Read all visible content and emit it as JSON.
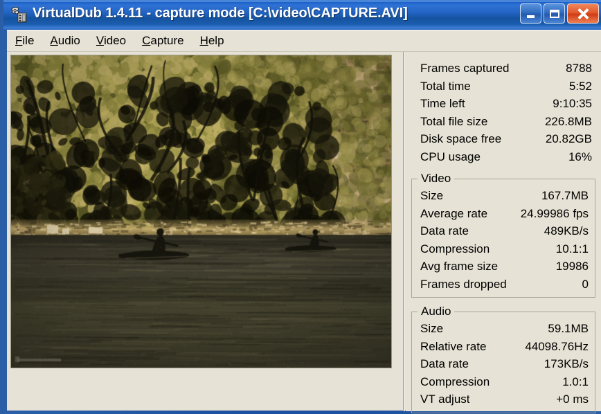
{
  "window": {
    "title": "VirtualDub 1.4.11 - capture mode [C:\\video\\CAPTURE.AVI]",
    "icon": "virtualdub-gear-icon",
    "titlebar_color": "#1d63cb",
    "client_bg": "#e6e2d5",
    "caption_buttons": {
      "minimize": "minimize-icon",
      "maximize": "maximize-icon",
      "close": "close-icon"
    }
  },
  "menubar": {
    "items": [
      {
        "label": "File",
        "accel": "F"
      },
      {
        "label": "Audio",
        "accel": "A"
      },
      {
        "label": "Video",
        "accel": "V"
      },
      {
        "label": "Capture",
        "accel": "C"
      },
      {
        "label": "Help",
        "accel": "H"
      }
    ]
  },
  "preview": {
    "name": "video-preview",
    "description": "Live capture preview: two kayakers paddling on a dark river below a sunlit vegetated cliff"
  },
  "stats": {
    "general": [
      {
        "label": "Frames captured",
        "value": "8788"
      },
      {
        "label": "Total time",
        "value": "5:52"
      },
      {
        "label": "Time left",
        "value": "9:10:35"
      },
      {
        "label": "Total file size",
        "value": "226.8MB"
      },
      {
        "label": "Disk space free",
        "value": "20.82GB"
      },
      {
        "label": "CPU usage",
        "value": "16%"
      }
    ],
    "video": {
      "legend": "Video",
      "rows": [
        {
          "label": "Size",
          "value": "167.7MB"
        },
        {
          "label": "Average rate",
          "value": "24.99986 fps"
        },
        {
          "label": "Data rate",
          "value": "489KB/s"
        },
        {
          "label": "Compression",
          "value": "10.1:1"
        },
        {
          "label": "Avg frame size",
          "value": "19986"
        },
        {
          "label": "Frames dropped",
          "value": "0"
        }
      ]
    },
    "audio": {
      "legend": "Audio",
      "rows": [
        {
          "label": "Size",
          "value": "59.1MB"
        },
        {
          "label": "Relative rate",
          "value": "44098.76Hz"
        },
        {
          "label": "Data rate",
          "value": "173KB/s"
        },
        {
          "label": "Compression",
          "value": "1.0:1"
        },
        {
          "label": "VT adjust",
          "value": "+0 ms"
        }
      ]
    }
  }
}
